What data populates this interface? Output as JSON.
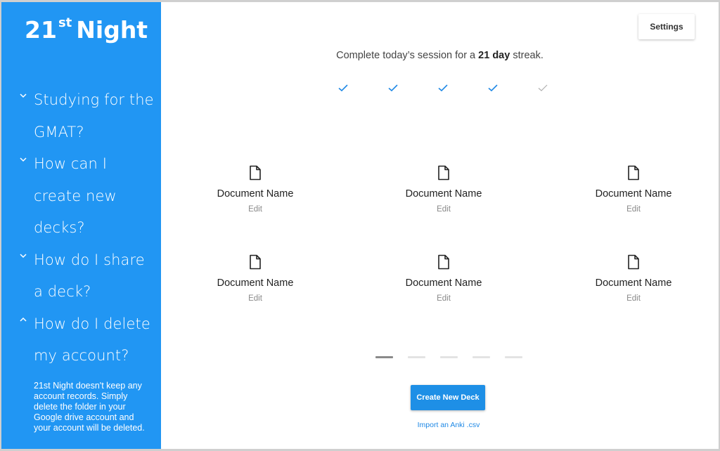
{
  "app": {
    "logo_main": "21",
    "logo_sup": "st",
    "logo_rest": "Night"
  },
  "sidebar": {
    "faq": [
      {
        "question": "Studying for the GMAT?",
        "expanded": false
      },
      {
        "question": "How can I create new decks?",
        "expanded": false
      },
      {
        "question": "How do I share a deck?",
        "expanded": false
      },
      {
        "question": "How do I delete my account?",
        "expanded": true,
        "answer": "21st Night doesn't keep any account records. Simply delete the folder in your Google drive account and your account will be deleted."
      }
    ]
  },
  "header": {
    "settings_label": "Settings"
  },
  "streak": {
    "prefix": "Complete today’s session for a ",
    "days": "21 day",
    "suffix": " streak.",
    "checks_completed": 4,
    "checks_total": 5
  },
  "decks": [
    {
      "name": "Document Name",
      "action": "Edit"
    },
    {
      "name": "Document Name",
      "action": "Edit"
    },
    {
      "name": "Document Name",
      "action": "Edit"
    },
    {
      "name": "Document Name",
      "action": "Edit"
    },
    {
      "name": "Document Name",
      "action": "Edit"
    },
    {
      "name": "Document Name",
      "action": "Edit"
    }
  ],
  "pagination": {
    "total_pages": 5,
    "current_page": 1
  },
  "actions": {
    "create_label": "Create New Deck",
    "import_label": "Import an Anki .csv"
  },
  "colors": {
    "sidebar": "#2196f3",
    "accent": "#1e88e5",
    "check_done": "#1e88e5",
    "check_pending": "#b0b0b0"
  },
  "icons": {
    "faq_collapsed": "chevron-down-icon",
    "faq_expanded": "chevron-up-icon",
    "deck": "document-icon",
    "streak_day": "checkmark-icon"
  }
}
